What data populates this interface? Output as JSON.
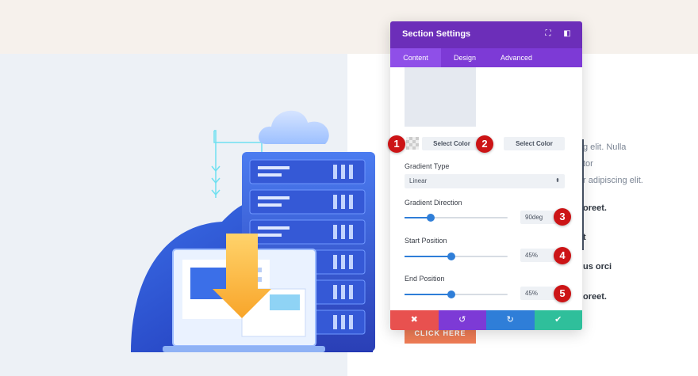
{
  "panel": {
    "title": "Section Settings",
    "tabs": [
      {
        "label": "Content",
        "active": true
      },
      {
        "label": "Design",
        "active": false
      },
      {
        "label": "Advanced",
        "active": false
      }
    ],
    "header_icons": [
      "expand-icon",
      "sidebar-toggle-icon"
    ],
    "color_pickers": {
      "select_color_1": "Select Color",
      "select_color_2": "Select Color"
    },
    "gradient_type": {
      "label": "Gradient Type",
      "value": "Linear"
    },
    "gradient_direction": {
      "label": "Gradient Direction",
      "value": "90deg",
      "slider_fraction": 0.25
    },
    "start_position": {
      "label": "Start Position",
      "value": "45%",
      "slider_fraction": 0.45
    },
    "end_position": {
      "label": "End Position",
      "value": "45%",
      "slider_fraction": 0.45
    },
    "footer_buttons": [
      {
        "name": "cancel",
        "icon": "close-icon",
        "glyph": "✖",
        "color": "#e8514f"
      },
      {
        "name": "undo",
        "icon": "undo-icon",
        "glyph": "↺",
        "color": "#7d3ad6"
      },
      {
        "name": "redo",
        "icon": "redo-icon",
        "glyph": "↻",
        "color": "#2f7ed8"
      },
      {
        "name": "save",
        "icon": "check-icon",
        "glyph": "✔",
        "color": "#2fbf9b"
      }
    ]
  },
  "markers": [
    "1",
    "2",
    "3",
    "4",
    "5"
  ],
  "background": {
    "text_lines": [
      "g elit. Nulla",
      "tor",
      "r adipiscing elit."
    ],
    "bold_lines": [
      "oreet.",
      "t",
      "us orci",
      "oreet."
    ],
    "cta_label": "CLICK HERE"
  },
  "colors": {
    "header": "#6c2eb9",
    "tabs": "#7d3ad6",
    "accent": "#2f7ed8",
    "marker": "#cc1416",
    "cta": "#ef7c55"
  }
}
